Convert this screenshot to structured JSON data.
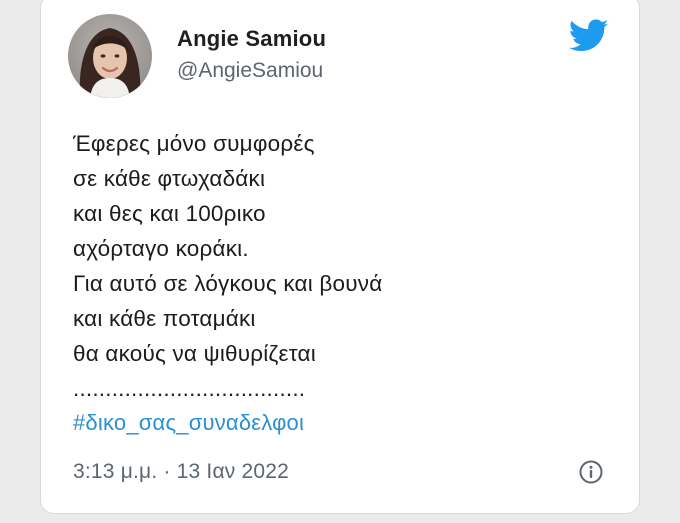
{
  "author": {
    "name": "Angie Samiou",
    "handle": "@AngieSamiou"
  },
  "tweet": {
    "lines": [
      "Έφερες μόνο συμφορές",
      "σε κάθε φτωχαδάκι",
      "και θες και 100ρικο",
      "αχόρταγο κοράκι.",
      "Για αυτό σε λόγκους και βουνά",
      "και κάθε ποταμάκι",
      "θα ακούς να ψιθυρίζεται",
      "...................................."
    ],
    "hashtag": "#δικο_σας_συναδελφοι",
    "timestamp": "3:13 μ.μ. · 13 Ιαν 2022"
  },
  "icons": {
    "brand": "twitter-bird-icon",
    "info": "info-icon"
  },
  "colors": {
    "brand_blue": "#1d9bf0",
    "hashtag": "#2c8fd1",
    "muted_text": "#5b6670",
    "primary_text": "#1c1c1c"
  }
}
